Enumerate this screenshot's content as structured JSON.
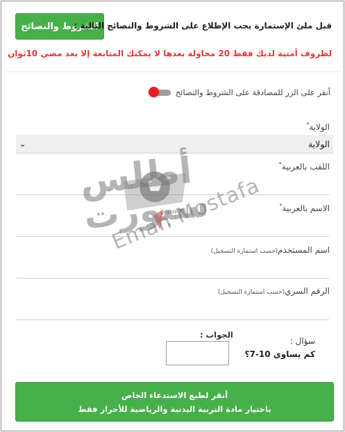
{
  "terms": {
    "button_label": "الشروط والنصائح",
    "note": "قبل ملئ الإستمارة يجب الإطلاع على الشروط والنصائح التالية :"
  },
  "warning": "لظروف أمنية لديك فقط 20 محاولة بعدها لا يمكنك المتابعة إلا بعد مضي 10ثوان",
  "agree": {
    "label": "أنقر على الزر للمصادقة على الشروط والنصائح",
    "checked": false
  },
  "wilaya": {
    "label": "الولاية",
    "required_mark": "*",
    "selected": "الولاية"
  },
  "fields": {
    "surname": {
      "label": "اللقب بالعربية",
      "required_mark": "*",
      "value": ""
    },
    "name": {
      "label": "الاسم بالعربية",
      "required_mark": "*",
      "value": ""
    },
    "username": {
      "label": "اسم المستخدم",
      "note": "(حسب استمارة التسجيل)",
      "value": ""
    },
    "password": {
      "label": "الرقم السري",
      "note": "(حسب استمارة التسجيل)",
      "value": ""
    }
  },
  "captcha": {
    "question_label": "سؤال :",
    "question": "كم يساوي 10-7؟",
    "answer_label": "الجواب :",
    "answer_value": ""
  },
  "print_button": {
    "line1": "أنقر لطبع الاستدعاء الخاص",
    "line2": "باختيار مادة التربية البدنية والرياضية للأحرار فقط"
  },
  "watermark": {
    "arabic_line1": "أطلس",
    "arabic_line2": "سبورت",
    "site": "atlassport",
    "name": "Eman Mostafa"
  },
  "colors": {
    "accent_green": "#47b04b",
    "warning_red": "#e53935",
    "toggle_knob": "#e02020"
  }
}
